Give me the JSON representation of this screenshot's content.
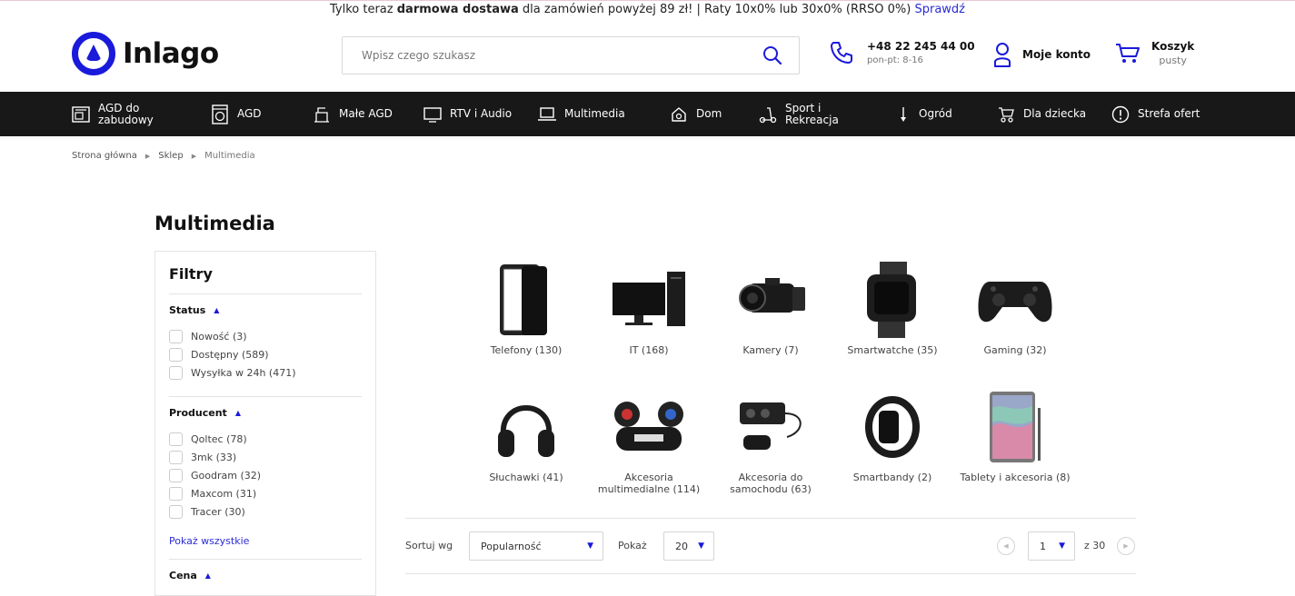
{
  "topbar": {
    "prefix": "Tylko teraz ",
    "bold": "darmowa dostawa",
    "middle": " dla zamówień powyżej 89 zł! | Raty 10x0% lub 30x0% (RRSO 0%) ",
    "link": "Sprawdź"
  },
  "header": {
    "logo": "Inlago",
    "search_placeholder": "Wpisz czego szukasz",
    "phone": "+48 22 245 44 00",
    "phone_hours": "pon-pt: 8-16",
    "account": "Moje konto",
    "cart_title": "Koszyk",
    "cart_status": "pusty"
  },
  "nav": [
    {
      "label": "AGD do zabudowy",
      "icon": "built-in-appliance-icon"
    },
    {
      "label": "AGD",
      "icon": "washing-machine-icon"
    },
    {
      "label": "Małe AGD",
      "icon": "small-appliance-icon"
    },
    {
      "label": "RTV i Audio",
      "icon": "tv-icon"
    },
    {
      "label": "Multimedia",
      "icon": "laptop-icon"
    },
    {
      "label": "Dom",
      "icon": "home-icon"
    },
    {
      "label": "Sport i Rekreacja",
      "icon": "scooter-icon"
    },
    {
      "label": "Ogród",
      "icon": "garden-tool-icon"
    },
    {
      "label": "Dla dziecka",
      "icon": "stroller-icon"
    },
    {
      "label": "Strefa ofert",
      "icon": "exclamation-icon"
    }
  ],
  "breadcrumb": [
    "Strona główna",
    "Sklep",
    "Multimedia"
  ],
  "page_title": "Multimedia",
  "filters": {
    "title": "Filtry",
    "status": {
      "heading": "Status",
      "options": [
        "Nowość (3)",
        "Dostępny (589)",
        "Wysyłka w 24h (471)"
      ]
    },
    "producer": {
      "heading": "Producent",
      "options": [
        "Qoltec (78)",
        "3mk (33)",
        "Goodram (32)",
        "Maxcom (31)",
        "Tracer (30)"
      ]
    },
    "show_all": "Pokaż wszystkie",
    "price": {
      "heading": "Cena"
    }
  },
  "categories": [
    {
      "label": "Telefony (130)",
      "icon": "smartphone-icon"
    },
    {
      "label": "IT (168)",
      "icon": "computer-monitor-icon"
    },
    {
      "label": "Kamery (7)",
      "icon": "camcorder-icon"
    },
    {
      "label": "Smartwatche (35)",
      "icon": "smartwatch-icon"
    },
    {
      "label": "Gaming (32)",
      "icon": "gamepad-icon"
    },
    {
      "label": "Słuchawki (41)",
      "icon": "headphones-icon"
    },
    {
      "label": "Akcesoria multimedialne (114)",
      "icon": "speaker-icon"
    },
    {
      "label": "Akcesoria do samochodu (63)",
      "icon": "car-charger-icon"
    },
    {
      "label": "Smartbandy (2)",
      "icon": "smartband-icon"
    },
    {
      "label": "Tablety i akcesoria (8)",
      "icon": "tablet-icon"
    }
  ],
  "toolbar": {
    "sort_label": "Sortuj wg",
    "sort_value": "Popularność",
    "show_label": "Pokaż",
    "show_value": "20",
    "page_value": "1",
    "page_total": "z 30"
  },
  "colors": {
    "accent": "#1a1adb",
    "nav_bg": "#181818"
  }
}
